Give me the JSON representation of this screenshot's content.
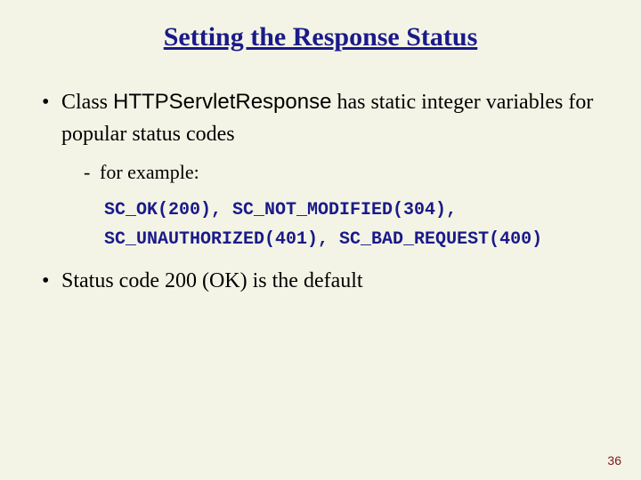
{
  "title": "Setting the Response Status",
  "bullets": [
    {
      "pre": "Class ",
      "class_name": "HTTPServletResponse",
      "post": " has static integer variables for popular status codes"
    },
    {
      "text": "Status code 200 (OK) is the default"
    }
  ],
  "sub_label": "for example:",
  "code_line1": "SC_OK(200), SC_NOT_MODIFIED(304),",
  "code_line2": "SC_UNAUTHORIZED(401), SC_BAD_REQUEST(400)",
  "page_number": "36"
}
